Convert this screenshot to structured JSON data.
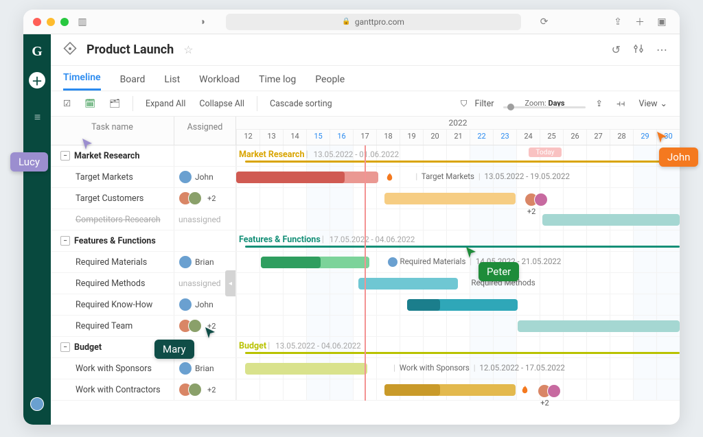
{
  "browser": {
    "url": "ganttpro.com"
  },
  "page": {
    "title": "Product Launch"
  },
  "navTabs": [
    "Timeline",
    "Board",
    "List",
    "Workload",
    "Time log",
    "People"
  ],
  "activeTab": "Timeline",
  "toolbar": {
    "expand": "Expand All",
    "collapse": "Collapse All",
    "cascade": "Cascade sorting",
    "filter": "Filter",
    "zoomLabel": "Zoom:",
    "zoomUnit": "Days",
    "view": "View"
  },
  "columns": {
    "name": "Task name",
    "assigned": "Assigned"
  },
  "timeline": {
    "year": "2022",
    "days": [
      12,
      13,
      14,
      15,
      16,
      17,
      18,
      19,
      20,
      21,
      22,
      23,
      24,
      25,
      26,
      27,
      28,
      29,
      30
    ],
    "weekendIdx": [
      3,
      4,
      10,
      11,
      17,
      18
    ],
    "todayLabel": "Today",
    "todayIdx": 5
  },
  "groups": [
    {
      "name": "Market Research",
      "dates": "13.05.2022 - 01.06.2022",
      "color": "#d9a400",
      "lineFrom": 0.02,
      "lineTo": 1.0
    },
    {
      "name": "Features & Functions",
      "dates": "17.05.2022 - 04.06.2022",
      "color": "#148f77",
      "lineFrom": 0.02,
      "lineTo": 1.0
    },
    {
      "name": "Budget",
      "dates": "13.05.2022 - 04.06.2022",
      "color": "#b9c200",
      "lineFrom": 0.02,
      "lineTo": 1.0
    }
  ],
  "tasks": {
    "g0": [
      {
        "name": "Target Markets",
        "assigned": {
          "type": "one",
          "label": "John"
        },
        "bars": [
          {
            "from": 0.0,
            "to": 0.32,
            "color": "#ea9892"
          },
          {
            "from": 0.0,
            "to": 0.245,
            "color": "#d05a52"
          }
        ],
        "flameAt": 0.335,
        "label": {
          "x": 0.4,
          "text": "Target Markets",
          "dates": "13.05.2022 - 19.05.2022",
          "pipe": true
        }
      },
      {
        "name": "Target Customers",
        "assigned": {
          "type": "multi",
          "count": "+2"
        },
        "bars": [
          {
            "from": 0.335,
            "to": 0.63,
            "color": "#f6cd83"
          }
        ],
        "label": {
          "x": 0.65,
          "avatars": true,
          "count": "+2"
        }
      },
      {
        "name": "Competitors Research",
        "strike": true,
        "assigned": {
          "type": "un",
          "label": "unassigned"
        },
        "bars": [
          {
            "from": 0.69,
            "to": 1.0,
            "color": "#a5d7d2"
          }
        ]
      }
    ],
    "g1": [
      {
        "name": "Required Materials",
        "assigned": {
          "type": "one",
          "label": "Brian"
        },
        "bars": [
          {
            "from": 0.055,
            "to": 0.3,
            "color": "#7cd39a"
          },
          {
            "from": 0.055,
            "to": 0.19,
            "color": "#2f9e5f"
          }
        ],
        "label": {
          "x": 0.34,
          "text": "Required Materials",
          "dates": "14.05.2022 - 21.05.2022",
          "av": true
        }
      },
      {
        "name": "Required Methods",
        "assigned": {
          "type": "un",
          "label": "unassigned"
        },
        "bars": [
          {
            "from": 0.275,
            "to": 0.5,
            "color": "#6fc7d3"
          }
        ],
        "label": {
          "x": 0.53,
          "text": "Required Methods"
        },
        "stub": true
      },
      {
        "name": "Required Know-How",
        "assigned": {
          "type": "one",
          "label": "John"
        },
        "bars": [
          {
            "from": 0.385,
            "to": 0.635,
            "color": "#2fa7b8"
          },
          {
            "from": 0.385,
            "to": 0.46,
            "color": "#1b7e8c"
          }
        ]
      },
      {
        "name": "Required Team",
        "assigned": {
          "type": "multi",
          "count": "+2"
        },
        "bars": [
          {
            "from": 0.635,
            "to": 1.0,
            "color": "#a5d7d2"
          }
        ]
      }
    ],
    "g2": [
      {
        "name": "Work with Sponsors",
        "assigned": {
          "type": "one",
          "label": "Brian"
        },
        "bars": [
          {
            "from": 0.02,
            "to": 0.295,
            "color": "#d9e28c"
          }
        ],
        "label": {
          "x": 0.35,
          "text": "Work with Sponsors",
          "dates": "12.05.2022 - 17.05.2022",
          "pipe": true
        }
      },
      {
        "name": "Work with Contractors",
        "assigned": {
          "type": "multi",
          "count": "+2"
        },
        "bars": [
          {
            "from": 0.335,
            "to": 0.63,
            "color": "#e3b94e"
          },
          {
            "from": 0.335,
            "to": 0.46,
            "color": "#c99a2a"
          }
        ],
        "flameAt": 0.64,
        "label": {
          "x": 0.68,
          "avatars": true,
          "count": "+2"
        }
      }
    ]
  },
  "cursors": {
    "lucy": {
      "name": "Lucy",
      "color": "#9b8ecf"
    },
    "john": {
      "name": "John",
      "color": "#f4791f"
    },
    "peter": {
      "name": "Peter",
      "color": "#1e8c3a"
    },
    "mary": {
      "name": "Mary",
      "color": "#0f4d47"
    }
  }
}
